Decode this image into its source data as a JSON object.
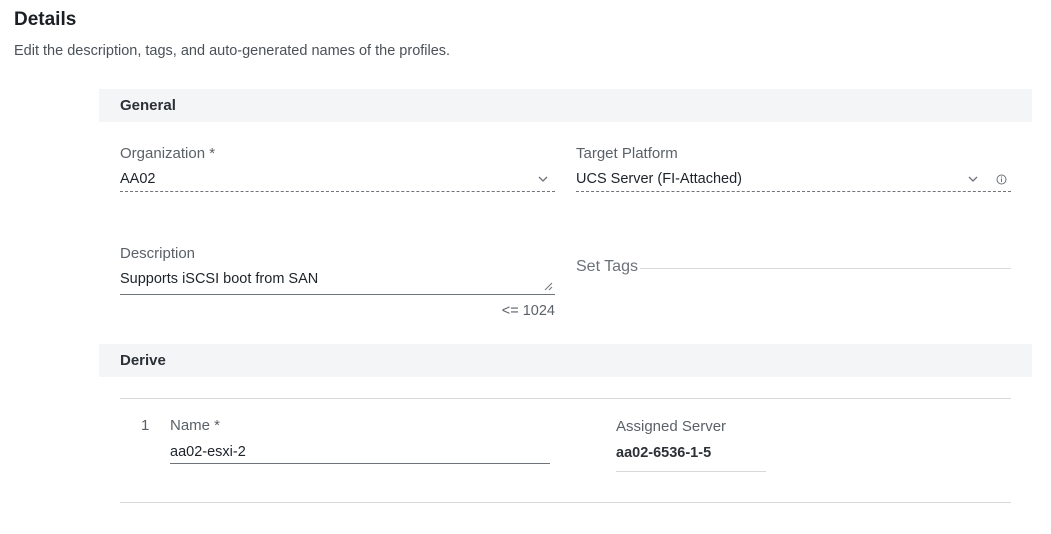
{
  "header": {
    "title": "Details",
    "subtitle": "Edit the description, tags, and auto-generated names of the profiles."
  },
  "general": {
    "section_title": "General",
    "organization": {
      "label": "Organization *",
      "value": "AA02"
    },
    "target_platform": {
      "label": "Target Platform",
      "value": "UCS Server (FI-Attached)"
    },
    "description": {
      "label": "Description",
      "value": "Supports iSCSI boot from SAN",
      "limit": "<= 1024"
    },
    "tags": {
      "label": "Set Tags"
    }
  },
  "derive": {
    "section_title": "Derive",
    "rows": [
      {
        "index": "1",
        "name_label": "Name *",
        "name_value": "aa02-esxi-2",
        "server_label": "Assigned Server",
        "server_value": "aa02-6536-1-5"
      }
    ]
  },
  "icons": {
    "dropdown": "chevron-down-icon",
    "info": "info-icon",
    "resize": "resize-handle-icon"
  }
}
